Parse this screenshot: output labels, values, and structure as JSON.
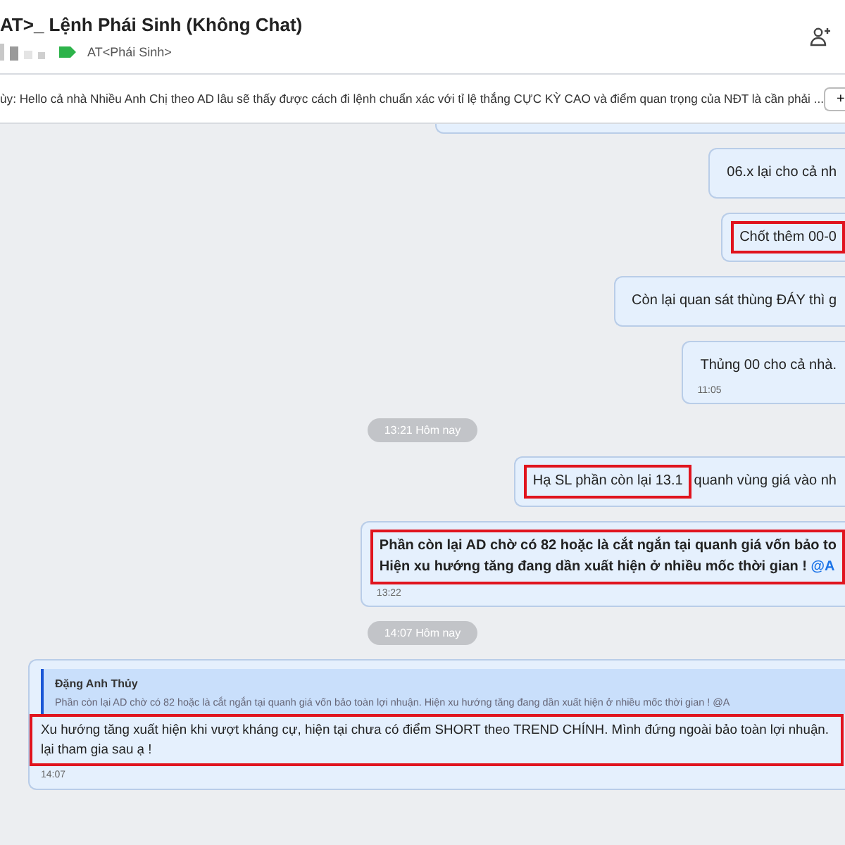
{
  "header": {
    "title": "AT>_ Lệnh Phái Sinh (Không Chat)",
    "tag": "AT<Phái Sinh>"
  },
  "pinned": {
    "text": "ùy: Hello cả nhà Nhiều Anh Chị theo AD lâu sẽ thấy được cách đi lệnh chuẩn xác với tỉ lệ thắng CỰC KỲ CAO và điểm quan trọng của NĐT là cần phải ...",
    "button": "+"
  },
  "messages": [
    {
      "kind": "cut"
    },
    {
      "kind": "outgoing",
      "blocks": [
        {
          "highlighted": false,
          "bold": false,
          "lines": [
            [
              {
                "text": "06.x lại cho cả nh",
                "mention": false
              }
            ]
          ]
        }
      ]
    },
    {
      "kind": "outgoing",
      "blocks": [
        {
          "highlighted": true,
          "bold": false,
          "lines": [
            [
              {
                "text": "Chốt thêm 00-0",
                "mention": false
              }
            ]
          ]
        }
      ]
    },
    {
      "kind": "outgoing",
      "blocks": [
        {
          "highlighted": false,
          "bold": false,
          "lines": [
            [
              {
                "text": "Còn lại quan sát thùng ĐÁY thì g",
                "mention": false
              }
            ]
          ]
        }
      ]
    },
    {
      "kind": "outgoing",
      "blocks": [
        {
          "highlighted": false,
          "bold": false,
          "lines": [
            [
              {
                "text": "Thủng 00 cho cả nhà.",
                "mention": false
              }
            ]
          ]
        }
      ],
      "time": "11:05"
    },
    {
      "kind": "separator",
      "text": "13:21 Hôm nay"
    },
    {
      "kind": "outgoing",
      "blocks": [
        {
          "highlighted": true,
          "bold": false,
          "lines": [
            [
              {
                "text": "Hạ SL phần còn lại 13.1",
                "mention": false
              }
            ]
          ]
        },
        {
          "highlighted": false,
          "bold": false,
          "lines": [
            [
              {
                "text": "quanh vùng giá vào nh",
                "mention": false
              }
            ]
          ]
        }
      ]
    },
    {
      "kind": "outgoing",
      "blocks": [
        {
          "highlighted": true,
          "bold": true,
          "lines": [
            [
              {
                "text": "Phần còn lại AD chờ có 82 hoặc là cắt ngắn tại quanh giá vốn bảo to",
                "mention": false
              }
            ],
            [
              {
                "text": "Hiện xu hướng tăng đang dần xuất hiện ở nhiều mốc thời gian !",
                "mention": false
              },
              {
                "text": "@A",
                "mention": true
              }
            ]
          ]
        }
      ],
      "time": "13:22"
    },
    {
      "kind": "separator",
      "text": "14:07 Hôm nay"
    },
    {
      "kind": "incoming",
      "quote": {
        "author": "Đặng Anh Thủy",
        "text": "Phần còn lại AD chờ có 82 hoặc là cắt ngắn tại quanh giá vốn bảo toàn lợi nhuận. Hiện xu hướng tăng đang dần xuất hiện ở nhiều mốc thời gian ! @A"
      },
      "blocks": [
        {
          "highlighted": true,
          "bold": false,
          "lines": [
            [
              {
                "text": "Xu hướng tăng xuất hiện khi vượt kháng cự, hiện tại chưa có điểm SHORT theo TREND CHÍNH. Mình đứng ngoài bảo toàn lợi nhuận.",
                "mention": false
              }
            ],
            [
              {
                "text": "lại tham gia sau ạ !",
                "mention": false
              }
            ]
          ]
        }
      ],
      "time": "14:07"
    }
  ]
}
